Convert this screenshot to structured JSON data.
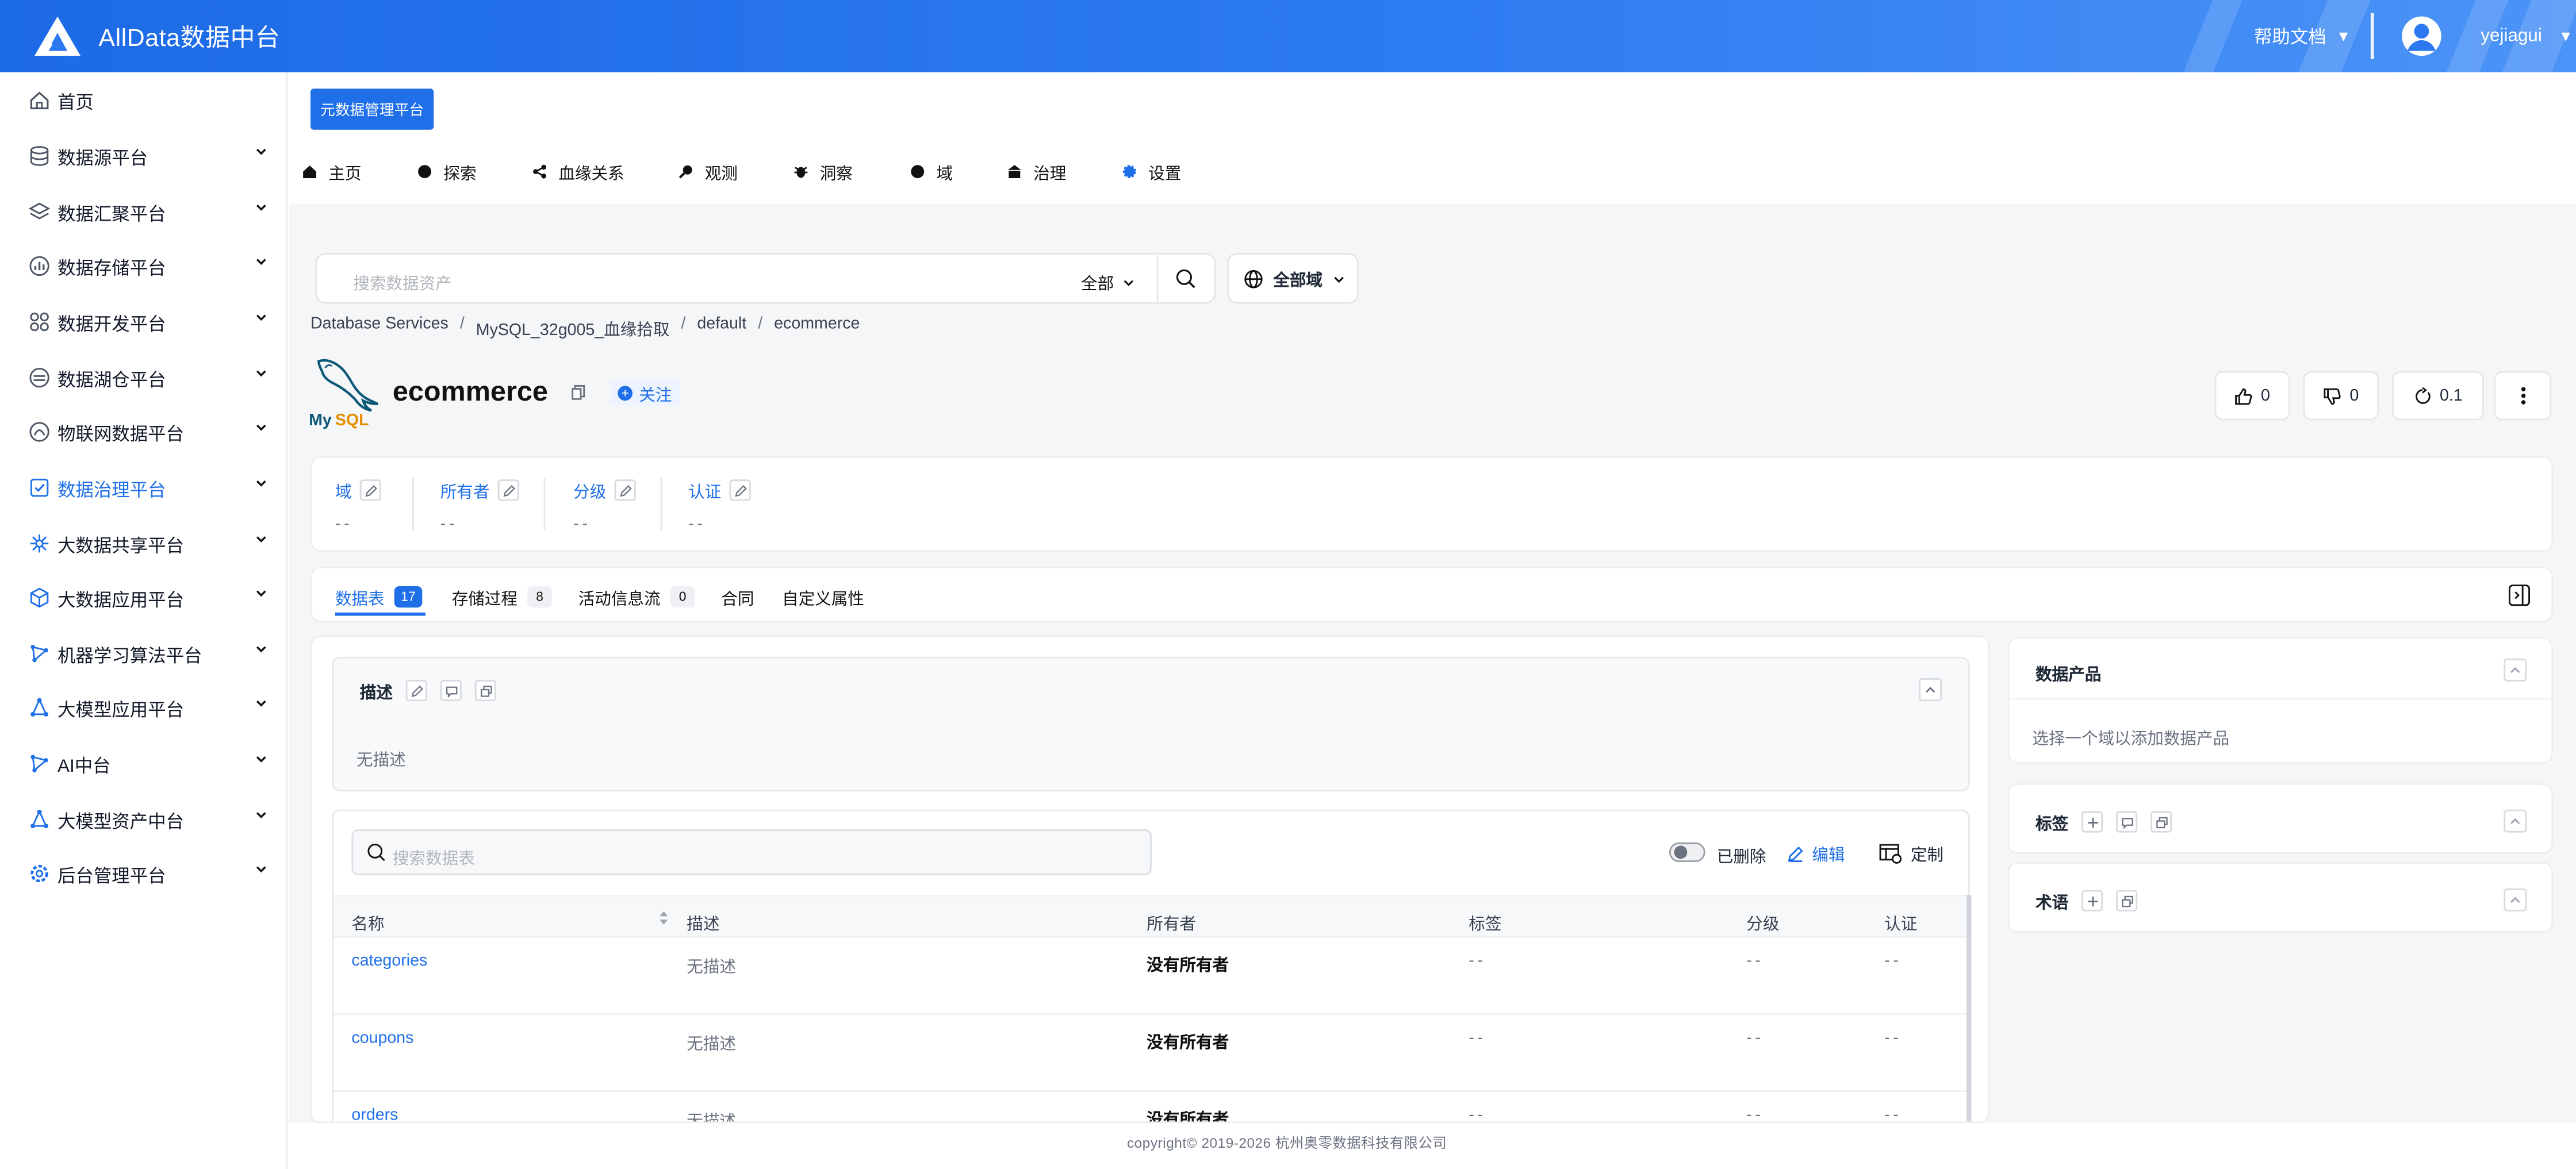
{
  "app": {
    "brand_name": "AllData数据中台",
    "help_label": "帮助文档",
    "help_caret": "▼",
    "user_name": "yejiagui",
    "user_caret": "▼",
    "brand_color": "#1f6fe8"
  },
  "sidebar": {
    "items": [
      {
        "label": "首页",
        "icon": "home-icon",
        "has_children": false
      },
      {
        "label": "数据源平台",
        "icon": "database-icon",
        "has_children": true
      },
      {
        "label": "数据汇聚平台",
        "icon": "layers-icon",
        "has_children": true
      },
      {
        "label": "数据存储平台",
        "icon": "bar-chart-icon",
        "has_children": true
      },
      {
        "label": "数据开发平台",
        "icon": "grid-icon",
        "has_children": true
      },
      {
        "label": "数据湖仓平台",
        "icon": "lake-icon",
        "has_children": true
      },
      {
        "label": "物联网数据平台",
        "icon": "iot-icon",
        "has_children": true
      },
      {
        "label": "数据治理平台",
        "icon": "governance-icon",
        "has_children": true,
        "active": true
      },
      {
        "label": "大数据共享平台",
        "icon": "share-icon",
        "has_children": true
      },
      {
        "label": "大数据应用平台",
        "icon": "cube-icon",
        "has_children": true
      },
      {
        "label": "机器学习算法平台",
        "icon": "ml-icon",
        "has_children": true
      },
      {
        "label": "大模型应用平台",
        "icon": "model-icon",
        "has_children": true
      },
      {
        "label": "AI中台",
        "icon": "ai-icon",
        "has_children": true
      },
      {
        "label": "大模型资产中台",
        "icon": "asset-icon",
        "has_children": true
      },
      {
        "label": "后台管理平台",
        "icon": "settings-icon",
        "has_children": true
      }
    ]
  },
  "main": {
    "meta_button": "元数据管理平台",
    "nav": [
      {
        "label": "主页",
        "icon": "home-icon"
      },
      {
        "label": "探索",
        "icon": "explore-icon"
      },
      {
        "label": "血缘关系",
        "icon": "lineage-icon"
      },
      {
        "label": "观测",
        "icon": "observe-icon"
      },
      {
        "label": "洞察",
        "icon": "insight-icon"
      },
      {
        "label": "域",
        "icon": "domain-icon"
      },
      {
        "label": "治理",
        "icon": "governance-icon"
      },
      {
        "label": "设置",
        "icon": "gear-icon"
      }
    ],
    "search": {
      "placeholder": "搜索数据资产",
      "scope": "全部",
      "domain_label": "全部域"
    },
    "breadcrumb": [
      "Database Services",
      "MySQL_32g005_血缘拾取",
      "default",
      "ecommerce"
    ],
    "entity": {
      "name": "ecommerce",
      "follow_label": "关注",
      "likes": "0",
      "dislikes": "0",
      "version": "0.1"
    },
    "properties": [
      {
        "label": "域",
        "value": "--"
      },
      {
        "label": "所有者",
        "value": "--"
      },
      {
        "label": "分级",
        "value": "--"
      },
      {
        "label": "认证",
        "value": "--"
      }
    ],
    "tabs": [
      {
        "label": "数据表",
        "count": "17",
        "active": true
      },
      {
        "label": "存储过程",
        "count": "8"
      },
      {
        "label": "活动信息流",
        "count": "0"
      },
      {
        "label": "合同",
        "count": ""
      },
      {
        "label": "自定义属性",
        "count": ""
      }
    ],
    "description": {
      "title": "描述",
      "value": "无描述"
    },
    "table": {
      "search_placeholder": "搜索数据表",
      "deleted_label": "已删除",
      "edit_label": "编辑",
      "custom_label": "定制",
      "columns": [
        "名称",
        "描述",
        "所有者",
        "标签",
        "分级",
        "认证"
      ],
      "rows": [
        {
          "name": "categories",
          "desc": "无描述",
          "owner": "没有所有者",
          "tags": "--",
          "tier": "--",
          "cert": "--"
        },
        {
          "name": "coupons",
          "desc": "无描述",
          "owner": "没有所有者",
          "tags": "--",
          "tier": "--",
          "cert": "--"
        },
        {
          "name": "orders",
          "desc": "无描述",
          "owner": "没有所有者",
          "tags": "--",
          "tier": "--",
          "cert": "--"
        }
      ]
    },
    "right": {
      "data_product_title": "数据产品",
      "data_product_desc": "选择一个域以添加数据产品",
      "tags_title": "标签",
      "glossary_title": "术语"
    },
    "footer": "copyright© 2019-2026 杭州奥零数据科技有限公司"
  }
}
